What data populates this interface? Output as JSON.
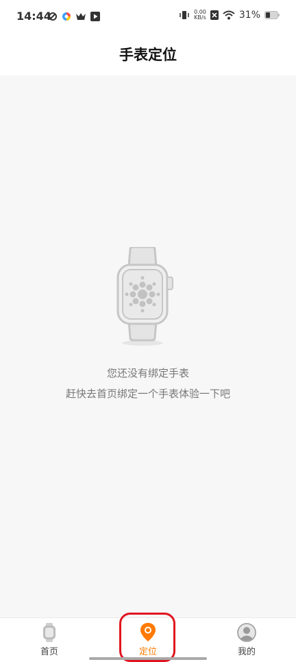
{
  "status_bar": {
    "time": "14:44",
    "speed_value": "0.00",
    "speed_unit": "KB/s",
    "battery": "31%"
  },
  "header": {
    "title": "手表定位"
  },
  "empty_state": {
    "line1": "您还没有绑定手表",
    "line2": "赶快去首页绑定一个手表体验一下吧"
  },
  "nav": {
    "items": [
      {
        "label": "首页",
        "icon": "watch-icon"
      },
      {
        "label": "定位",
        "icon": "location-pin-icon",
        "active": true
      },
      {
        "label": "我的",
        "icon": "profile-icon"
      }
    ]
  },
  "colors": {
    "accent": "#ff7a00",
    "highlight": "#e0141e",
    "background": "#f7f7f7"
  }
}
